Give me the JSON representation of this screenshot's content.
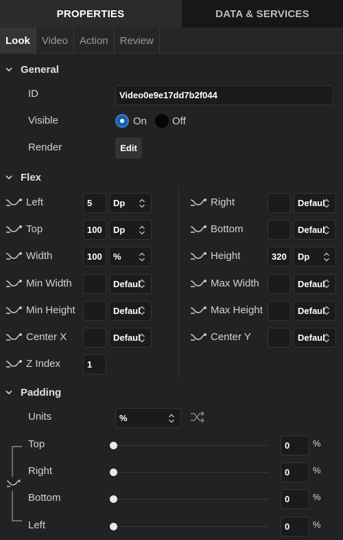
{
  "top_tabs": {
    "properties": "PROPERTIES",
    "data_services": "DATA & SERVICES"
  },
  "sub_tabs": [
    "Look",
    "Video",
    "Action",
    "Review"
  ],
  "general": {
    "title": "General",
    "id_label": "ID",
    "id_value": "Video0e9e17dd7b2f044",
    "visible_label": "Visible",
    "on_label": "On",
    "off_label": "Off",
    "visible_selected": "On",
    "render_label": "Render",
    "edit_label": "Edit"
  },
  "flex": {
    "title": "Flex",
    "left": [
      {
        "label": "Left",
        "value": "5",
        "unit": "Dp"
      },
      {
        "label": "Top",
        "value": "100",
        "unit": "Dp"
      },
      {
        "label": "Width",
        "value": "100",
        "unit": "%"
      },
      {
        "label": "Min Width",
        "value": "",
        "unit": "Default"
      },
      {
        "label": "Min Height",
        "value": "",
        "unit": "Default"
      },
      {
        "label": "Center X",
        "value": "",
        "unit": "Default"
      },
      {
        "label": "Z Index",
        "value": "1",
        "unit": null
      }
    ],
    "right": [
      {
        "label": "Right",
        "value": "",
        "unit": "Default"
      },
      {
        "label": "Bottom",
        "value": "",
        "unit": "Default"
      },
      {
        "label": "Height",
        "value": "320",
        "unit": "Dp"
      },
      {
        "label": "Max Width",
        "value": "",
        "unit": "Default"
      },
      {
        "label": "Max Height",
        "value": "",
        "unit": "Default"
      },
      {
        "label": "Center Y",
        "value": "",
        "unit": "Default"
      }
    ]
  },
  "padding": {
    "title": "Padding",
    "units_label": "Units",
    "units_value": "%",
    "rows": [
      {
        "label": "Top",
        "value": "0",
        "unit": "%",
        "slider": 0
      },
      {
        "label": "Right",
        "value": "0",
        "unit": "%",
        "slider": 0
      },
      {
        "label": "Bottom",
        "value": "0",
        "unit": "%",
        "slider": 0
      },
      {
        "label": "Left",
        "value": "0",
        "unit": "%",
        "slider": 0
      }
    ]
  },
  "colors": {
    "accent": "#1c5fa8",
    "background": "#222222"
  }
}
